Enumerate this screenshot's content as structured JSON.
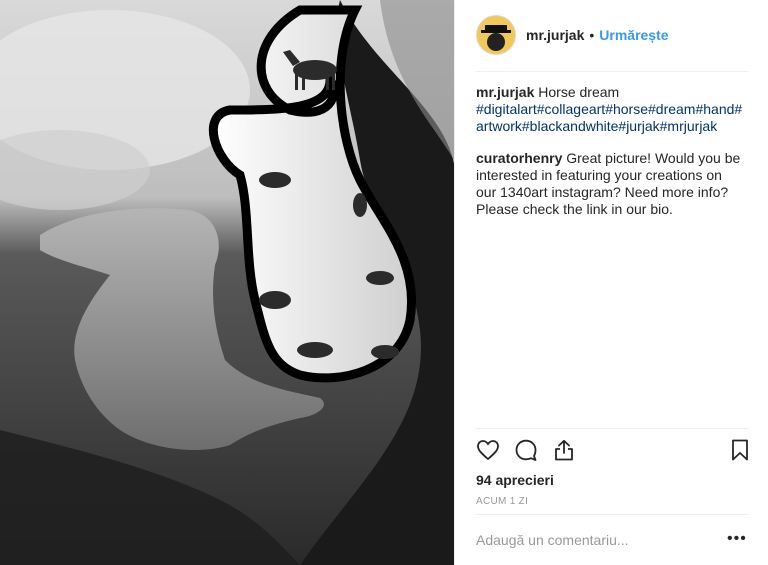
{
  "post": {
    "username": "mr.jurjak",
    "separator": "•",
    "follow_label": "Urmărește",
    "caption_text": "Horse dream",
    "hashtags": "#digitalart#collageart#horse#dream#hand#artwork#blackandwhite#jurjak#mrjurjak",
    "comment_user": "curatorhenry",
    "comment_text": "Great picture! Would you be interested in featuring your creations on our 1340art instagram? Need more info? Please check the link in our bio.",
    "likes": "94 aprecieri",
    "time": "ACUM 1 ZI",
    "add_comment_placeholder": "Adaugă un comentariu...",
    "more_label": "•••"
  },
  "icons": [
    "heart-icon",
    "comment-icon",
    "share-icon",
    "bookmark-icon",
    "more-options-icon"
  ],
  "colors": {
    "link": "#3897f0",
    "hashtag": "#003569",
    "text": "#262626",
    "muted": "#999999"
  }
}
